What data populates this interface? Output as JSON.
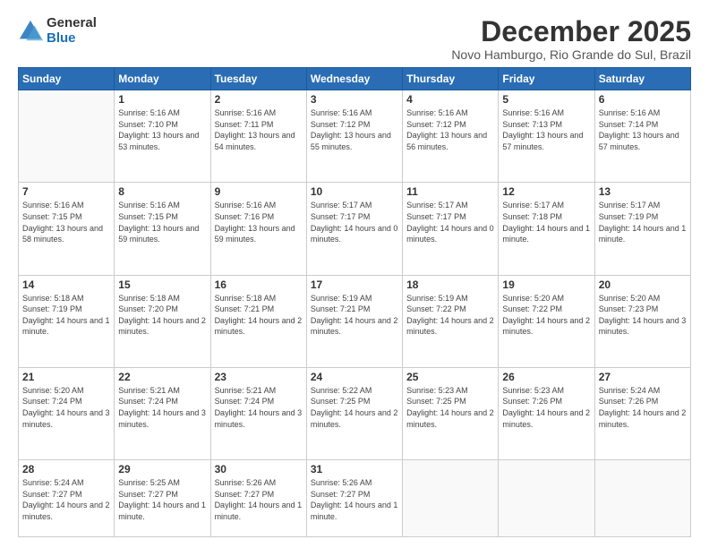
{
  "logo": {
    "general": "General",
    "blue": "Blue"
  },
  "header": {
    "month": "December 2025",
    "location": "Novo Hamburgo, Rio Grande do Sul, Brazil"
  },
  "weekdays": [
    "Sunday",
    "Monday",
    "Tuesday",
    "Wednesday",
    "Thursday",
    "Friday",
    "Saturday"
  ],
  "weeks": [
    [
      {
        "num": "",
        "sunrise": "",
        "sunset": "",
        "daylight": ""
      },
      {
        "num": "1",
        "sunrise": "Sunrise: 5:16 AM",
        "sunset": "Sunset: 7:10 PM",
        "daylight": "Daylight: 13 hours and 53 minutes."
      },
      {
        "num": "2",
        "sunrise": "Sunrise: 5:16 AM",
        "sunset": "Sunset: 7:11 PM",
        "daylight": "Daylight: 13 hours and 54 minutes."
      },
      {
        "num": "3",
        "sunrise": "Sunrise: 5:16 AM",
        "sunset": "Sunset: 7:12 PM",
        "daylight": "Daylight: 13 hours and 55 minutes."
      },
      {
        "num": "4",
        "sunrise": "Sunrise: 5:16 AM",
        "sunset": "Sunset: 7:12 PM",
        "daylight": "Daylight: 13 hours and 56 minutes."
      },
      {
        "num": "5",
        "sunrise": "Sunrise: 5:16 AM",
        "sunset": "Sunset: 7:13 PM",
        "daylight": "Daylight: 13 hours and 57 minutes."
      },
      {
        "num": "6",
        "sunrise": "Sunrise: 5:16 AM",
        "sunset": "Sunset: 7:14 PM",
        "daylight": "Daylight: 13 hours and 57 minutes."
      }
    ],
    [
      {
        "num": "7",
        "sunrise": "Sunrise: 5:16 AM",
        "sunset": "Sunset: 7:15 PM",
        "daylight": "Daylight: 13 hours and 58 minutes."
      },
      {
        "num": "8",
        "sunrise": "Sunrise: 5:16 AM",
        "sunset": "Sunset: 7:15 PM",
        "daylight": "Daylight: 13 hours and 59 minutes."
      },
      {
        "num": "9",
        "sunrise": "Sunrise: 5:16 AM",
        "sunset": "Sunset: 7:16 PM",
        "daylight": "Daylight: 13 hours and 59 minutes."
      },
      {
        "num": "10",
        "sunrise": "Sunrise: 5:17 AM",
        "sunset": "Sunset: 7:17 PM",
        "daylight": "Daylight: 14 hours and 0 minutes."
      },
      {
        "num": "11",
        "sunrise": "Sunrise: 5:17 AM",
        "sunset": "Sunset: 7:17 PM",
        "daylight": "Daylight: 14 hours and 0 minutes."
      },
      {
        "num": "12",
        "sunrise": "Sunrise: 5:17 AM",
        "sunset": "Sunset: 7:18 PM",
        "daylight": "Daylight: 14 hours and 1 minute."
      },
      {
        "num": "13",
        "sunrise": "Sunrise: 5:17 AM",
        "sunset": "Sunset: 7:19 PM",
        "daylight": "Daylight: 14 hours and 1 minute."
      }
    ],
    [
      {
        "num": "14",
        "sunrise": "Sunrise: 5:18 AM",
        "sunset": "Sunset: 7:19 PM",
        "daylight": "Daylight: 14 hours and 1 minute."
      },
      {
        "num": "15",
        "sunrise": "Sunrise: 5:18 AM",
        "sunset": "Sunset: 7:20 PM",
        "daylight": "Daylight: 14 hours and 2 minutes."
      },
      {
        "num": "16",
        "sunrise": "Sunrise: 5:18 AM",
        "sunset": "Sunset: 7:21 PM",
        "daylight": "Daylight: 14 hours and 2 minutes."
      },
      {
        "num": "17",
        "sunrise": "Sunrise: 5:19 AM",
        "sunset": "Sunset: 7:21 PM",
        "daylight": "Daylight: 14 hours and 2 minutes."
      },
      {
        "num": "18",
        "sunrise": "Sunrise: 5:19 AM",
        "sunset": "Sunset: 7:22 PM",
        "daylight": "Daylight: 14 hours and 2 minutes."
      },
      {
        "num": "19",
        "sunrise": "Sunrise: 5:20 AM",
        "sunset": "Sunset: 7:22 PM",
        "daylight": "Daylight: 14 hours and 2 minutes."
      },
      {
        "num": "20",
        "sunrise": "Sunrise: 5:20 AM",
        "sunset": "Sunset: 7:23 PM",
        "daylight": "Daylight: 14 hours and 3 minutes."
      }
    ],
    [
      {
        "num": "21",
        "sunrise": "Sunrise: 5:20 AM",
        "sunset": "Sunset: 7:24 PM",
        "daylight": "Daylight: 14 hours and 3 minutes."
      },
      {
        "num": "22",
        "sunrise": "Sunrise: 5:21 AM",
        "sunset": "Sunset: 7:24 PM",
        "daylight": "Daylight: 14 hours and 3 minutes."
      },
      {
        "num": "23",
        "sunrise": "Sunrise: 5:21 AM",
        "sunset": "Sunset: 7:24 PM",
        "daylight": "Daylight: 14 hours and 3 minutes."
      },
      {
        "num": "24",
        "sunrise": "Sunrise: 5:22 AM",
        "sunset": "Sunset: 7:25 PM",
        "daylight": "Daylight: 14 hours and 2 minutes."
      },
      {
        "num": "25",
        "sunrise": "Sunrise: 5:23 AM",
        "sunset": "Sunset: 7:25 PM",
        "daylight": "Daylight: 14 hours and 2 minutes."
      },
      {
        "num": "26",
        "sunrise": "Sunrise: 5:23 AM",
        "sunset": "Sunset: 7:26 PM",
        "daylight": "Daylight: 14 hours and 2 minutes."
      },
      {
        "num": "27",
        "sunrise": "Sunrise: 5:24 AM",
        "sunset": "Sunset: 7:26 PM",
        "daylight": "Daylight: 14 hours and 2 minutes."
      }
    ],
    [
      {
        "num": "28",
        "sunrise": "Sunrise: 5:24 AM",
        "sunset": "Sunset: 7:27 PM",
        "daylight": "Daylight: 14 hours and 2 minutes."
      },
      {
        "num": "29",
        "sunrise": "Sunrise: 5:25 AM",
        "sunset": "Sunset: 7:27 PM",
        "daylight": "Daylight: 14 hours and 1 minute."
      },
      {
        "num": "30",
        "sunrise": "Sunrise: 5:26 AM",
        "sunset": "Sunset: 7:27 PM",
        "daylight": "Daylight: 14 hours and 1 minute."
      },
      {
        "num": "31",
        "sunrise": "Sunrise: 5:26 AM",
        "sunset": "Sunset: 7:27 PM",
        "daylight": "Daylight: 14 hours and 1 minute."
      },
      {
        "num": "",
        "sunrise": "",
        "sunset": "",
        "daylight": ""
      },
      {
        "num": "",
        "sunrise": "",
        "sunset": "",
        "daylight": ""
      },
      {
        "num": "",
        "sunrise": "",
        "sunset": "",
        "daylight": ""
      }
    ]
  ]
}
